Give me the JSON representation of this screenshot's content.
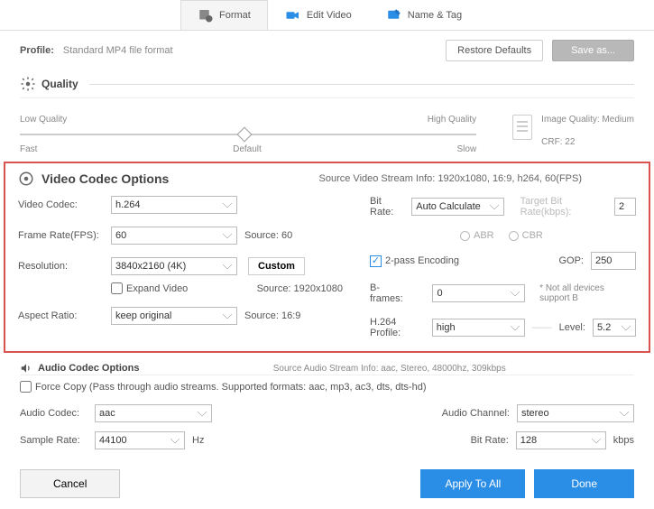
{
  "tabs": {
    "format": "Format",
    "editVideo": "Edit Video",
    "nameTag": "Name & Tag"
  },
  "profile": {
    "label": "Profile:",
    "value": "Standard MP4 file format",
    "restore": "Restore Defaults",
    "saveas": "Save as..."
  },
  "quality": {
    "title": "Quality",
    "lowQ": "Low Quality",
    "highQ": "High Quality",
    "fast": "Fast",
    "default": "Default",
    "slow": "Slow",
    "imgQuality": "Image Quality: Medium",
    "crf": "CRF: 22"
  },
  "video": {
    "title": "Video Codec Options",
    "sourceInfo": "Source Video Stream Info: 1920x1080, 16:9, h264, 60(FPS)",
    "codecLbl": "Video Codec:",
    "codec": "h.264",
    "fpsLbl": "Frame Rate(FPS):",
    "fps": "60",
    "fpsSrc": "Source: 60",
    "resLbl": "Resolution:",
    "res": "3840x2160 (4K)",
    "customBtn": "Custom",
    "expand": "Expand Video",
    "resSrc": "Source: 1920x1080",
    "arLbl": "Aspect Ratio:",
    "ar": "keep original",
    "arSrc": "Source: 16:9",
    "bitrateLbl": "Bit Rate:",
    "bitrate": "Auto Calculate",
    "targetLbl": "Target Bit Rate(kbps):",
    "target": "2",
    "abr": "ABR",
    "cbr": "CBR",
    "twopass": "2-pass Encoding",
    "gopLbl": "GOP:",
    "gop": "250",
    "bframesLbl": "B-frames:",
    "bframes": "0",
    "bframesNote": "* Not all devices support B",
    "profileLbl": "H.264 Profile:",
    "profile": "high",
    "levelLbl": "Level:",
    "level": "5.2"
  },
  "audio": {
    "title": "Audio Codec Options",
    "sourceInfo": "Source Audio Stream Info: aac, Stereo, 48000hz, 309kbps",
    "forceCopy": "Force Copy (Pass through audio streams. Supported formats: aac, mp3, ac3, dts, dts-hd)",
    "codecLbl": "Audio Codec:",
    "codec": "aac",
    "channelLbl": "Audio Channel:",
    "channel": "stereo",
    "sampleLbl": "Sample Rate:",
    "sample": "44100",
    "hz": "Hz",
    "bitrateLbl": "Bit Rate:",
    "bitrate": "128",
    "kbps": "kbps"
  },
  "footer": {
    "cancel": "Cancel",
    "apply": "Apply To All",
    "done": "Done"
  }
}
